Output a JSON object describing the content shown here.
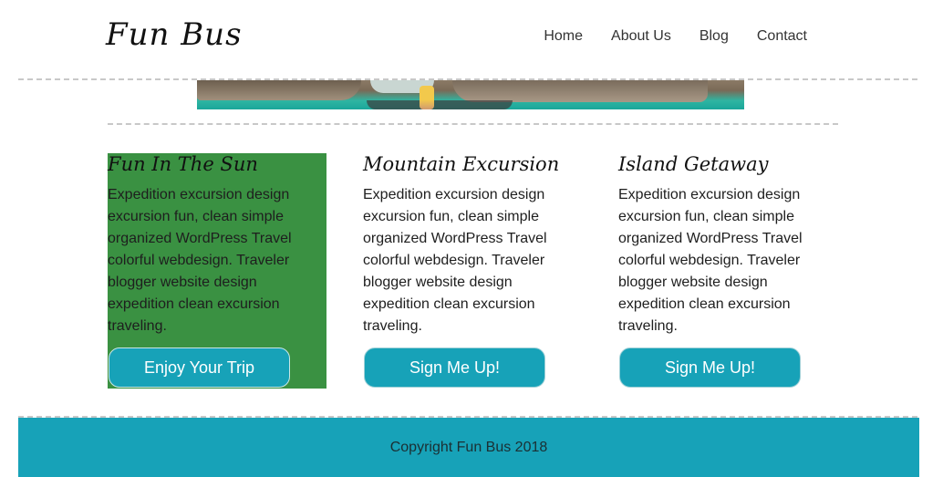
{
  "header": {
    "logo": "Fun Bus",
    "nav": [
      "Home",
      "About Us",
      "Blog",
      "Contact"
    ]
  },
  "cards": [
    {
      "title": "Fun In The Sun",
      "text": "Expedition excursion design excursion fun, clean simple organized WordPress Travel colorful webdesign. Traveler blogger website design expedition clean excursion traveling.",
      "button": "Enjoy Your Trip",
      "highlighted": true
    },
    {
      "title": "Mountain Excursion",
      "text": "Expedition excursion design excursion fun, clean simple organized WordPress Travel colorful webdesign. Traveler blogger website design expedition clean excursion traveling.",
      "button": "Sign Me Up!",
      "highlighted": false
    },
    {
      "title": "Island Getaway",
      "text": "Expedition excursion design excursion fun, clean simple organized WordPress Travel colorful webdesign. Traveler blogger website design expedition clean excursion traveling.",
      "button": "Sign Me Up!",
      "highlighted": false
    }
  ],
  "footer": {
    "copyright": "Copyright Fun Bus 2018"
  },
  "colors": {
    "accent": "#17a2b8",
    "highlight_card": "#3a9142"
  }
}
